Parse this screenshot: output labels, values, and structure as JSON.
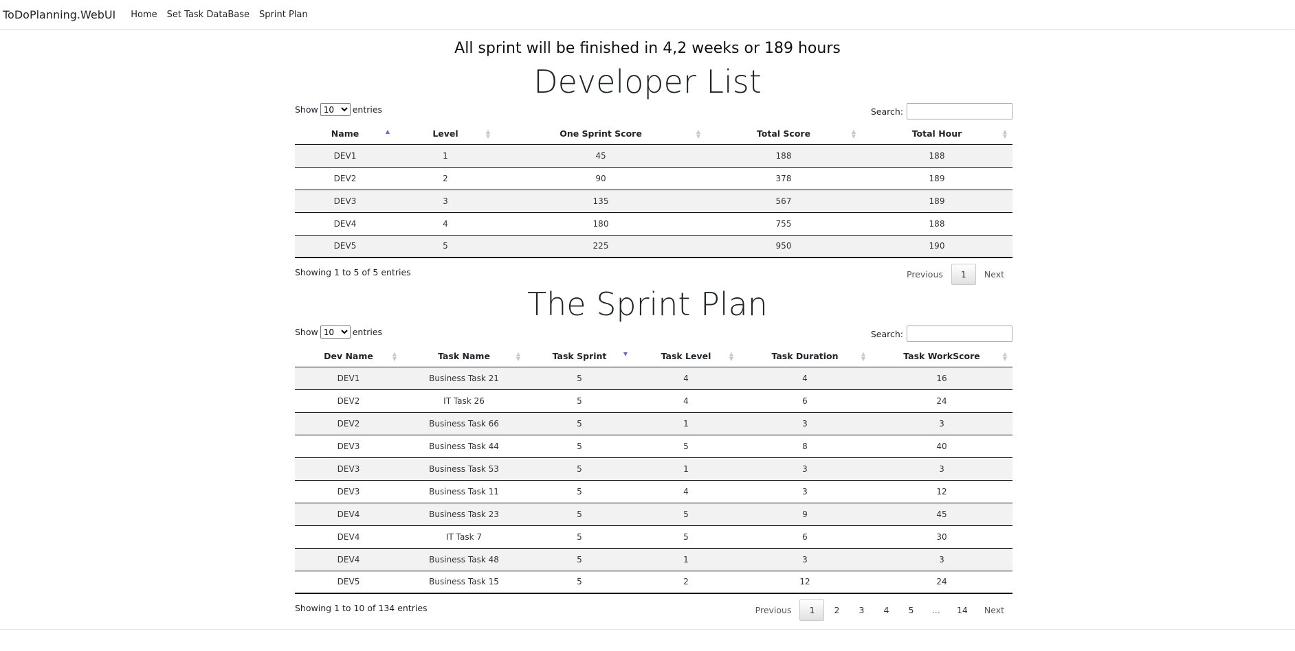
{
  "nav": {
    "brand": "ToDoPlanning.WebUI",
    "links": [
      "Home",
      "Set Task DataBase",
      "Sprint Plan"
    ]
  },
  "summary": "All sprint will be finished in 4,2 weeks or 189 hours",
  "developer": {
    "title": "Developer List",
    "show_label": "Show",
    "entries_label": "entries",
    "length_value": "10",
    "search_label": "Search:",
    "columns": [
      "Name",
      "Level",
      "One Sprint Score",
      "Total Score",
      "Total Hour"
    ],
    "rows": [
      [
        "DEV1",
        "1",
        "45",
        "188",
        "188"
      ],
      [
        "DEV2",
        "2",
        "90",
        "378",
        "189"
      ],
      [
        "DEV3",
        "3",
        "135",
        "567",
        "189"
      ],
      [
        "DEV4",
        "4",
        "180",
        "755",
        "188"
      ],
      [
        "DEV5",
        "5",
        "225",
        "950",
        "190"
      ]
    ],
    "info": "Showing 1 to 5 of 5 entries",
    "pagination": [
      "Previous",
      "1",
      "Next"
    ]
  },
  "sprint": {
    "title": "The Sprint Plan",
    "show_label": "Show",
    "entries_label": "entries",
    "length_value": "10",
    "search_label": "Search:",
    "columns": [
      "Dev Name",
      "Task Name",
      "Task Sprint",
      "Task Level",
      "Task Duration",
      "Task WorkScore"
    ],
    "rows": [
      [
        "DEV1",
        "Business Task 21",
        "5",
        "4",
        "4",
        "16"
      ],
      [
        "DEV2",
        "IT Task 26",
        "5",
        "4",
        "6",
        "24"
      ],
      [
        "DEV2",
        "Business Task 66",
        "5",
        "1",
        "3",
        "3"
      ],
      [
        "DEV3",
        "Business Task 44",
        "5",
        "5",
        "8",
        "40"
      ],
      [
        "DEV3",
        "Business Task 53",
        "5",
        "1",
        "3",
        "3"
      ],
      [
        "DEV3",
        "Business Task 11",
        "5",
        "4",
        "3",
        "12"
      ],
      [
        "DEV4",
        "Business Task 23",
        "5",
        "5",
        "9",
        "45"
      ],
      [
        "DEV4",
        "IT Task 7",
        "5",
        "5",
        "6",
        "30"
      ],
      [
        "DEV4",
        "Business Task 48",
        "5",
        "1",
        "3",
        "3"
      ],
      [
        "DEV5",
        "Business Task 15",
        "5",
        "2",
        "12",
        "24"
      ]
    ],
    "info": "Showing 1 to 10 of 134 entries",
    "pagination": [
      "Previous",
      "1",
      "2",
      "3",
      "4",
      "5",
      "…",
      "14",
      "Next"
    ]
  }
}
